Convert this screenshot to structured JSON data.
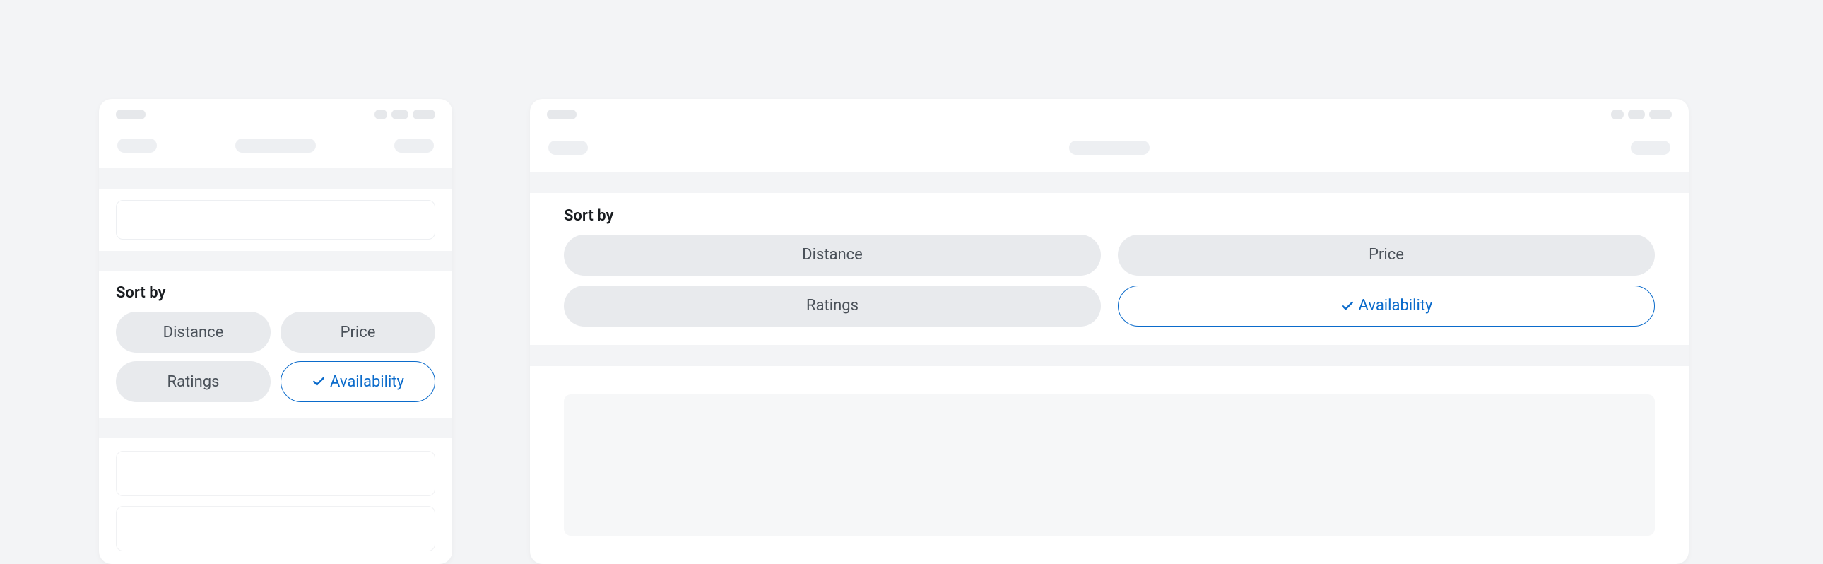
{
  "sort": {
    "label": "Sort by",
    "options": [
      {
        "label": "Distance",
        "selected": false
      },
      {
        "label": "Price",
        "selected": false
      },
      {
        "label": "Ratings",
        "selected": false
      },
      {
        "label": "Availability",
        "selected": true
      }
    ]
  },
  "colors": {
    "accent": "#0b6bcb",
    "chip_bg": "#e8eaed",
    "chip_text": "#4a5159"
  }
}
